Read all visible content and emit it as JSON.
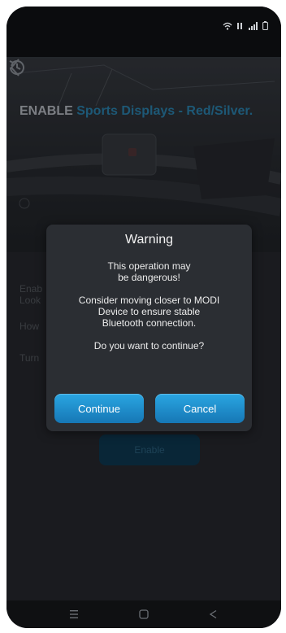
{
  "status_bar": {
    "icons": [
      "wifi-icon",
      "network-icon",
      "signal-icon",
      "battery-icon"
    ]
  },
  "header": {
    "back_icon": "chevron-left-icon",
    "history_icon": "history-icon",
    "title_prefix": "ENABLE",
    "title_highlight": "Sports Displays - Red/Silver."
  },
  "background_content": {
    "lines": [
      "Enab",
      "Look",
      "How",
      "Turn"
    ],
    "enable_button_label": "Enable"
  },
  "dialog": {
    "title": "Warning",
    "line1": "This operation may",
    "line2": "be dangerous!",
    "line3": "Consider moving closer to MODI",
    "line4": "Device to ensure stable",
    "line5": "Bluetooth connection.",
    "question": "Do you want to continue?",
    "continue_label": "Continue",
    "cancel_label": "Cancel"
  },
  "nav_bar": {
    "icons": [
      "recent-apps-icon",
      "home-icon",
      "back-triangle-icon"
    ]
  },
  "colors": {
    "accent": "#1e8fd0",
    "title_highlight": "#2f8fbf",
    "dialog_bg": "#2b2e33"
  }
}
